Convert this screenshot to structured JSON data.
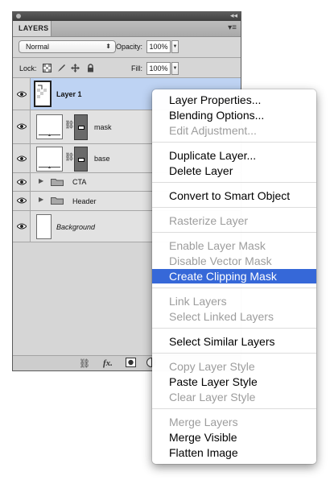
{
  "panel": {
    "tab_label": "LAYERS",
    "collapse_glyph": "◂◂",
    "menu_glyph": "▾≡",
    "blend_mode": "Normal",
    "opacity_label": "Opacity:",
    "opacity_value": "100%",
    "lock_label": "Lock:",
    "fill_label": "Fill:",
    "fill_value": "100%",
    "layers": [
      {
        "name": "Layer 1",
        "selected": true
      },
      {
        "name": "mask"
      },
      {
        "name": "base"
      },
      {
        "name": "CTA"
      },
      {
        "name": "Header"
      },
      {
        "name": "Background"
      }
    ],
    "footer_icons": [
      "link-layers-icon",
      "fx-icon",
      "add-mask-icon",
      "adjustment-icon"
    ],
    "fx_label": "fx."
  },
  "context_menu": {
    "items": [
      {
        "label": "Layer Properties...",
        "state": "enabled"
      },
      {
        "label": "Blending Options...",
        "state": "enabled"
      },
      {
        "label": "Edit Adjustment...",
        "state": "disabled"
      },
      {
        "label": "Duplicate Layer...",
        "state": "enabled"
      },
      {
        "label": "Delete Layer",
        "state": "enabled"
      },
      {
        "label": "Convert to Smart Object",
        "state": "enabled"
      },
      {
        "label": "Rasterize Layer",
        "state": "disabled"
      },
      {
        "label": "Enable Layer Mask",
        "state": "disabled"
      },
      {
        "label": "Disable Vector Mask",
        "state": "disabled"
      },
      {
        "label": "Create Clipping Mask",
        "state": "highlighted"
      },
      {
        "label": "Link Layers",
        "state": "disabled"
      },
      {
        "label": "Select Linked Layers",
        "state": "disabled"
      },
      {
        "label": "Select Similar Layers",
        "state": "enabled"
      },
      {
        "label": "Copy Layer Style",
        "state": "disabled"
      },
      {
        "label": "Paste Layer Style",
        "state": "enabled"
      },
      {
        "label": "Clear Layer Style",
        "state": "disabled"
      },
      {
        "label": "Merge Layers",
        "state": "disabled"
      },
      {
        "label": "Merge Visible",
        "state": "enabled"
      },
      {
        "label": "Flatten Image",
        "state": "enabled"
      }
    ]
  },
  "colors": {
    "highlight": "#3668d8",
    "selected_layer": "#bed3f3",
    "disabled_text": "#9d9d9d"
  }
}
